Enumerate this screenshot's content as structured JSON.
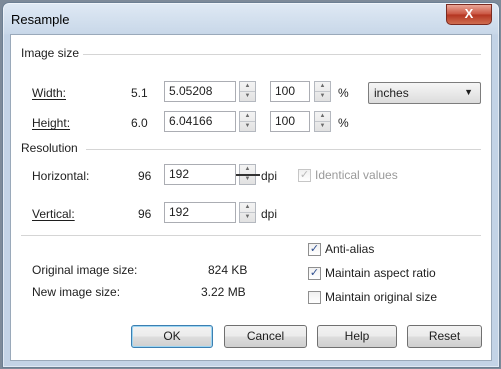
{
  "dialog": {
    "title": "Resample",
    "close_symbol": "X"
  },
  "image_size": {
    "section_label": "Image size",
    "width": {
      "label": "Width:",
      "original": "5.1",
      "value": "5.05208",
      "percent": "100",
      "percent_sign": "%"
    },
    "height": {
      "label": "Height:",
      "original": "6.0",
      "value": "6.04166",
      "percent": "100",
      "percent_sign": "%"
    },
    "units": {
      "selected": "inches"
    }
  },
  "resolution": {
    "section_label": "Resolution",
    "horizontal": {
      "label": "Horizontal:",
      "original": "96",
      "value": "192",
      "unit": "dpi"
    },
    "vertical": {
      "label": "Vertical:",
      "original": "96",
      "value": "192",
      "unit": "dpi"
    },
    "identical_values": {
      "label": "Identical values",
      "checked": true,
      "enabled": false
    }
  },
  "info": {
    "original_label": "Original image size:",
    "original_value": "824 KB",
    "new_label": "New image size:",
    "new_value": "3.22 MB"
  },
  "options": {
    "anti_alias": {
      "label": "Anti-alias",
      "checked": true
    },
    "maintain_aspect": {
      "label": "Maintain aspect ratio",
      "checked": true
    },
    "maintain_size": {
      "label": "Maintain original size",
      "checked": false
    }
  },
  "buttons": {
    "ok": "OK",
    "cancel": "Cancel",
    "help": "Help",
    "reset": "Reset"
  },
  "check_glyph": "✓",
  "spinner_up_glyph": "▲",
  "spinner_down_glyph": "▼",
  "dropdown_glyph": "▼"
}
